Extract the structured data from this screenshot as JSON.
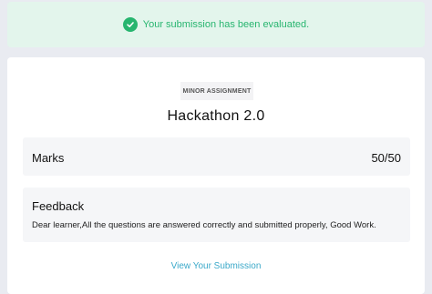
{
  "banner": {
    "message": "Your submission has been evaluated.",
    "icon": "check-circle-icon",
    "color": "#27b56f"
  },
  "assignment": {
    "tag": "MINOR ASSIGNMENT",
    "title": "Hackathon 2.0"
  },
  "marks": {
    "label": "Marks",
    "value": "50/50"
  },
  "feedback": {
    "heading": "Feedback",
    "text": "Dear learner,All the questions are answered correctly and submitted properly, Good Work."
  },
  "actions": {
    "view_submission": "View Your Submission"
  }
}
